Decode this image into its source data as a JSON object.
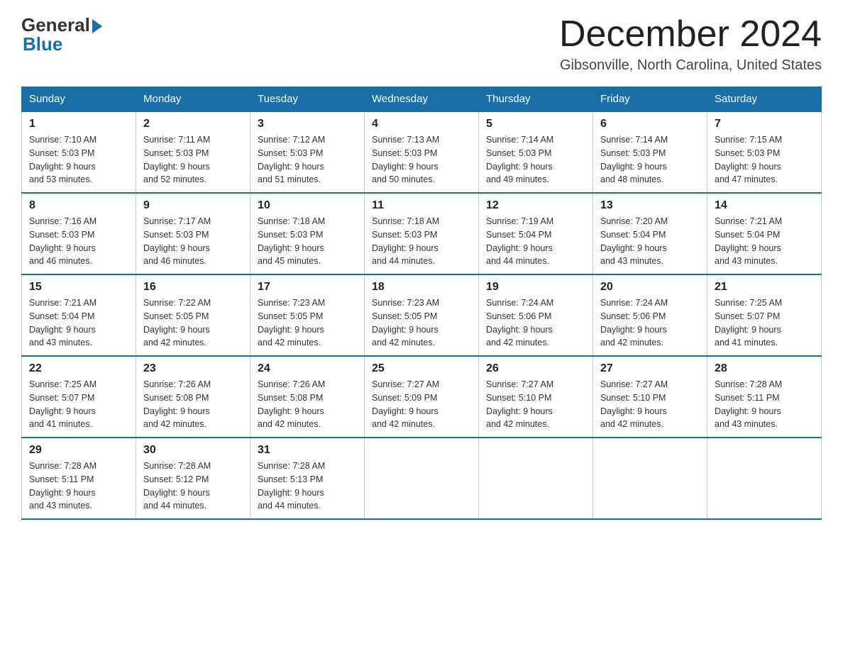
{
  "logo": {
    "general": "General",
    "blue": "Blue"
  },
  "header": {
    "title": "December 2024",
    "subtitle": "Gibsonville, North Carolina, United States"
  },
  "weekdays": [
    "Sunday",
    "Monday",
    "Tuesday",
    "Wednesday",
    "Thursday",
    "Friday",
    "Saturday"
  ],
  "weeks": [
    [
      {
        "day": "1",
        "sunrise": "7:10 AM",
        "sunset": "5:03 PM",
        "daylight": "9 hours and 53 minutes."
      },
      {
        "day": "2",
        "sunrise": "7:11 AM",
        "sunset": "5:03 PM",
        "daylight": "9 hours and 52 minutes."
      },
      {
        "day": "3",
        "sunrise": "7:12 AM",
        "sunset": "5:03 PM",
        "daylight": "9 hours and 51 minutes."
      },
      {
        "day": "4",
        "sunrise": "7:13 AM",
        "sunset": "5:03 PM",
        "daylight": "9 hours and 50 minutes."
      },
      {
        "day": "5",
        "sunrise": "7:14 AM",
        "sunset": "5:03 PM",
        "daylight": "9 hours and 49 minutes."
      },
      {
        "day": "6",
        "sunrise": "7:14 AM",
        "sunset": "5:03 PM",
        "daylight": "9 hours and 48 minutes."
      },
      {
        "day": "7",
        "sunrise": "7:15 AM",
        "sunset": "5:03 PM",
        "daylight": "9 hours and 47 minutes."
      }
    ],
    [
      {
        "day": "8",
        "sunrise": "7:16 AM",
        "sunset": "5:03 PM",
        "daylight": "9 hours and 46 minutes."
      },
      {
        "day": "9",
        "sunrise": "7:17 AM",
        "sunset": "5:03 PM",
        "daylight": "9 hours and 46 minutes."
      },
      {
        "day": "10",
        "sunrise": "7:18 AM",
        "sunset": "5:03 PM",
        "daylight": "9 hours and 45 minutes."
      },
      {
        "day": "11",
        "sunrise": "7:18 AM",
        "sunset": "5:03 PM",
        "daylight": "9 hours and 44 minutes."
      },
      {
        "day": "12",
        "sunrise": "7:19 AM",
        "sunset": "5:04 PM",
        "daylight": "9 hours and 44 minutes."
      },
      {
        "day": "13",
        "sunrise": "7:20 AM",
        "sunset": "5:04 PM",
        "daylight": "9 hours and 43 minutes."
      },
      {
        "day": "14",
        "sunrise": "7:21 AM",
        "sunset": "5:04 PM",
        "daylight": "9 hours and 43 minutes."
      }
    ],
    [
      {
        "day": "15",
        "sunrise": "7:21 AM",
        "sunset": "5:04 PM",
        "daylight": "9 hours and 43 minutes."
      },
      {
        "day": "16",
        "sunrise": "7:22 AM",
        "sunset": "5:05 PM",
        "daylight": "9 hours and 42 minutes."
      },
      {
        "day": "17",
        "sunrise": "7:23 AM",
        "sunset": "5:05 PM",
        "daylight": "9 hours and 42 minutes."
      },
      {
        "day": "18",
        "sunrise": "7:23 AM",
        "sunset": "5:05 PM",
        "daylight": "9 hours and 42 minutes."
      },
      {
        "day": "19",
        "sunrise": "7:24 AM",
        "sunset": "5:06 PM",
        "daylight": "9 hours and 42 minutes."
      },
      {
        "day": "20",
        "sunrise": "7:24 AM",
        "sunset": "5:06 PM",
        "daylight": "9 hours and 42 minutes."
      },
      {
        "day": "21",
        "sunrise": "7:25 AM",
        "sunset": "5:07 PM",
        "daylight": "9 hours and 41 minutes."
      }
    ],
    [
      {
        "day": "22",
        "sunrise": "7:25 AM",
        "sunset": "5:07 PM",
        "daylight": "9 hours and 41 minutes."
      },
      {
        "day": "23",
        "sunrise": "7:26 AM",
        "sunset": "5:08 PM",
        "daylight": "9 hours and 42 minutes."
      },
      {
        "day": "24",
        "sunrise": "7:26 AM",
        "sunset": "5:08 PM",
        "daylight": "9 hours and 42 minutes."
      },
      {
        "day": "25",
        "sunrise": "7:27 AM",
        "sunset": "5:09 PM",
        "daylight": "9 hours and 42 minutes."
      },
      {
        "day": "26",
        "sunrise": "7:27 AM",
        "sunset": "5:10 PM",
        "daylight": "9 hours and 42 minutes."
      },
      {
        "day": "27",
        "sunrise": "7:27 AM",
        "sunset": "5:10 PM",
        "daylight": "9 hours and 42 minutes."
      },
      {
        "day": "28",
        "sunrise": "7:28 AM",
        "sunset": "5:11 PM",
        "daylight": "9 hours and 43 minutes."
      }
    ],
    [
      {
        "day": "29",
        "sunrise": "7:28 AM",
        "sunset": "5:11 PM",
        "daylight": "9 hours and 43 minutes."
      },
      {
        "day": "30",
        "sunrise": "7:28 AM",
        "sunset": "5:12 PM",
        "daylight": "9 hours and 44 minutes."
      },
      {
        "day": "31",
        "sunrise": "7:28 AM",
        "sunset": "5:13 PM",
        "daylight": "9 hours and 44 minutes."
      },
      null,
      null,
      null,
      null
    ]
  ],
  "labels": {
    "sunrise": "Sunrise:",
    "sunset": "Sunset:",
    "daylight": "Daylight:"
  }
}
